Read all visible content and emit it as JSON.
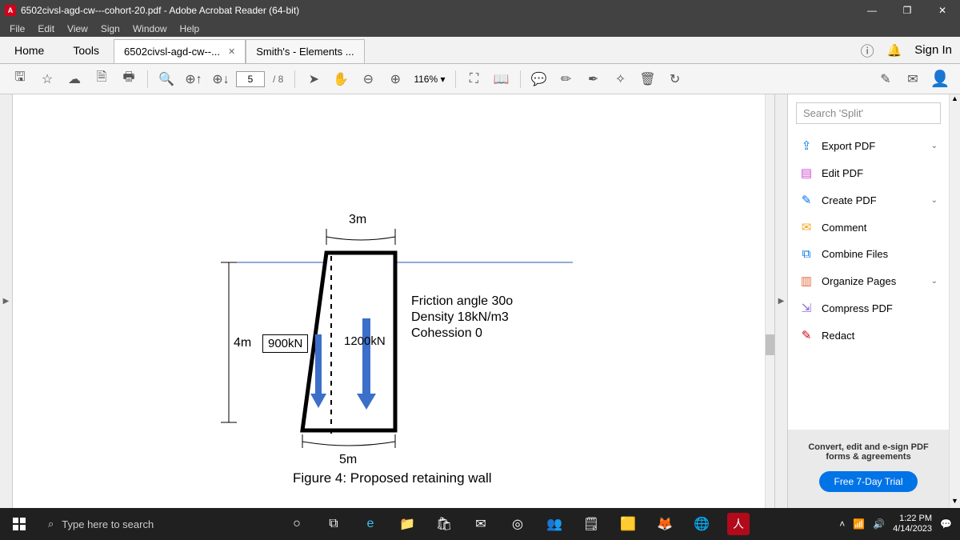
{
  "window": {
    "title": "6502civsl-agd-cw---cohort-20.pdf - Adobe Acrobat Reader (64-bit)"
  },
  "menu": [
    "File",
    "Edit",
    "View",
    "Sign",
    "Window",
    "Help"
  ],
  "tabs": {
    "home": "Home",
    "tools": "Tools",
    "doc1": "6502civsl-agd-cw--...",
    "doc2": "Smith's - Elements ..."
  },
  "topright": {
    "signin": "Sign In"
  },
  "toolbar": {
    "page": "5",
    "pages": "/ 8",
    "zoom": "116%"
  },
  "rpanel": {
    "search_ph": "Search 'Split'",
    "items": [
      {
        "icon": "⇪",
        "label": "Export PDF",
        "chev": true,
        "c": "#0073e7"
      },
      {
        "icon": "▤",
        "label": "Edit PDF",
        "c": "#d04fd0"
      },
      {
        "icon": "✎",
        "label": "Create PDF",
        "chev": true,
        "c": "#0073e7"
      },
      {
        "icon": "✉",
        "label": "Comment",
        "c": "#f5a623"
      },
      {
        "icon": "⧉",
        "label": "Combine Files",
        "c": "#0073e7"
      },
      {
        "icon": "▥",
        "label": "Organize Pages",
        "chev": true,
        "c": "#e06b3f"
      },
      {
        "icon": "⇲",
        "label": "Compress PDF",
        "c": "#8c6bd0"
      },
      {
        "icon": "✎",
        "label": "Redact",
        "c": "#d0021b"
      }
    ],
    "promo1": "Convert, edit and e-sign PDF",
    "promo2": "forms & agreements",
    "trial": "Free 7-Day Trial"
  },
  "figure": {
    "top_dim": "3m",
    "left_dim": "4m",
    "bottom_dim": "5m",
    "left_force": "900kN",
    "right_force": "1200kN",
    "prop1": "Friction angle 30o",
    "prop2": "Density 18kN/m3",
    "prop3": "Cohession 0",
    "caption": "Figure 4:  Proposed retaining wall"
  },
  "taskbar": {
    "search_ph": "Type here to search",
    "time": "1:22 PM",
    "date": "4/14/2023"
  }
}
